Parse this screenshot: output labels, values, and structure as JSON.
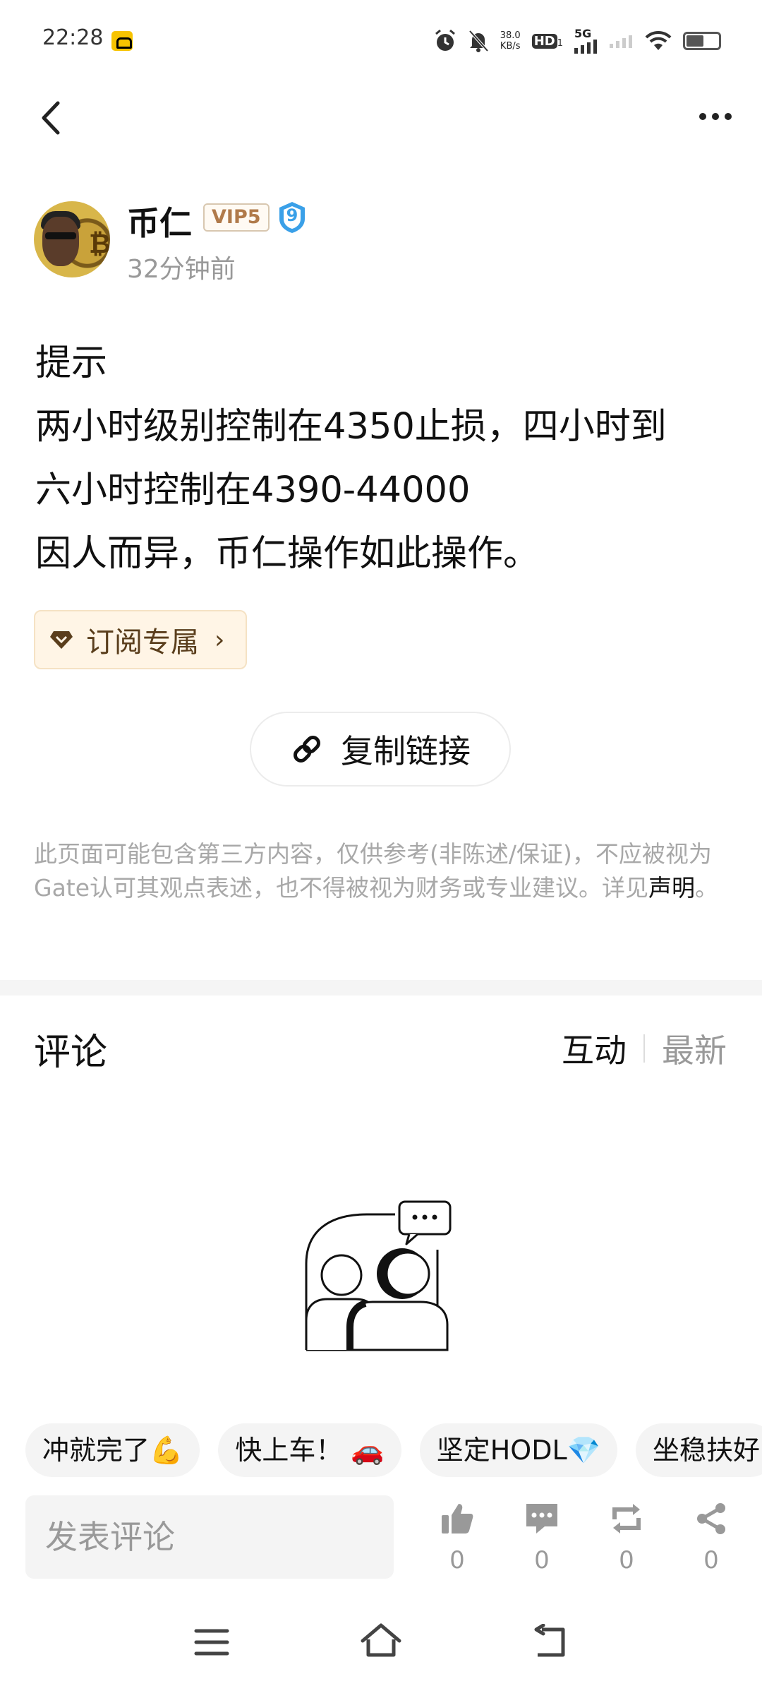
{
  "status_bar": {
    "time": "22:28",
    "net_speed_value": "38.0",
    "net_speed_unit": "KB/s",
    "hd_label": "HD",
    "hd_sub": "1",
    "signal_label": "5G",
    "icons": [
      "alarm-icon",
      "mute-icon",
      "wifi-icon",
      "battery-icon"
    ]
  },
  "nav": {
    "back_icon": "chevron-left-icon",
    "more_icon": "more-dots-icon"
  },
  "author": {
    "name": "币仁",
    "vip": "VIP5",
    "level": "9",
    "time_ago": "32分钟前"
  },
  "post": {
    "lines": [
      "提示",
      "两小时级别控制在4350止损，四小时到",
      "六小时控制在4390-44000",
      "因人而异，币仁操作如此操作。"
    ]
  },
  "subscription_chip": {
    "label": "订阅专属",
    "icon": "diamond-icon"
  },
  "copy_link": {
    "label": "复制链接",
    "icon": "link-icon"
  },
  "disclaimer": {
    "text": "此页面可能包含第三方内容，仅供参考(非陈述/保证)，不应被视为Gate认可其观点表述，也不得被视为财务或专业建议。详见",
    "link_text": "声明",
    "suffix": "。"
  },
  "comments": {
    "title": "评论",
    "sort_active": "互动",
    "sort_inactive": "最新"
  },
  "quick_replies": [
    "冲就完了💪",
    "快上车！ 🚗",
    "坚定HODL💎",
    "坐稳扶好"
  ],
  "bottom_bar": {
    "input_placeholder": "发表评论",
    "like_count": "0",
    "comment_count": "0",
    "repost_count": "0",
    "share_count": "0"
  },
  "colors": {
    "vip_text": "#b07a4a",
    "level_badge": "#3aa0e8",
    "chip_bg": "#fff5e6",
    "muted": "#999999"
  }
}
